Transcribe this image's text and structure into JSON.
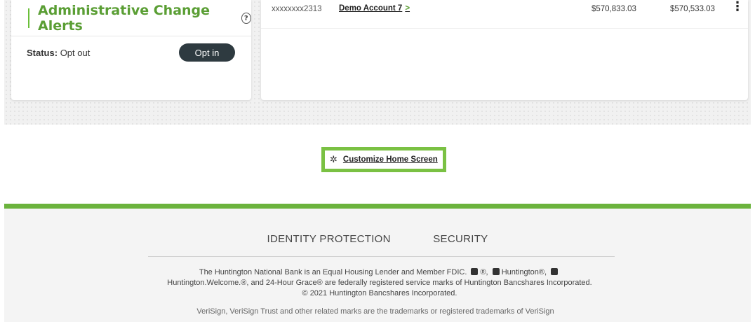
{
  "alerts": {
    "title": "Administrative Change Alerts",
    "help_glyph": "?",
    "status_label": "Status:",
    "status_value": "Opt out",
    "opt_in_label": "Opt in"
  },
  "accounts": {
    "rows": [
      {
        "number": "xxxxxxxx2313",
        "name": "Demo Account 7",
        "chevron": ">",
        "balance_current": "$570,833.03",
        "balance_available": "$570,533.03"
      }
    ]
  },
  "customize": {
    "label": "Customize Home Screen"
  },
  "footer": {
    "links": [
      "IDENTITY PROTECTION",
      "SECURITY"
    ],
    "legal_line1": "The Huntington National Bank is an Equal Housing Lender and Member FDIC.",
    "legal_mark1": "®,",
    "legal_brand": "Huntington",
    "legal_mark2": "®,",
    "legal_line2": "Huntington.Welcome.®, and 24-Hour Grace® are federally registered service marks of Huntington Bancshares Incorporated.",
    "legal_line3": "© 2021 Huntington Bancshares Incorporated.",
    "legal_line4": "VeriSign, VeriSign Trust and other related marks are the trademarks or registered trademarks of VeriSign"
  }
}
